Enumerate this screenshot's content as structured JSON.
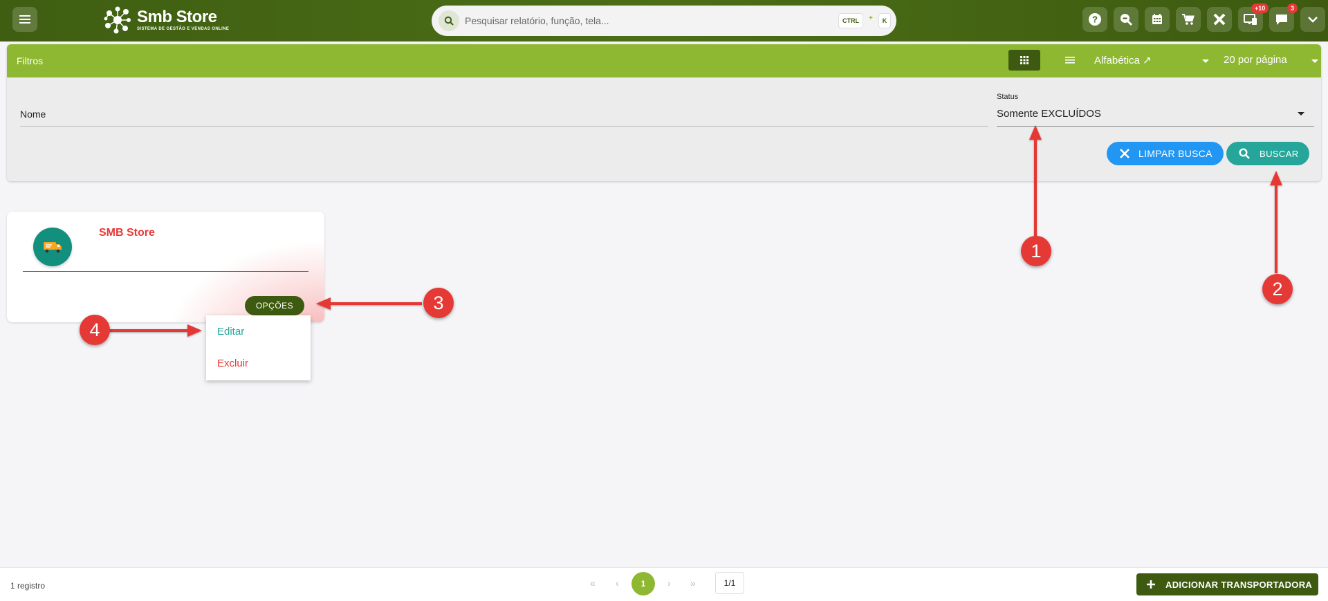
{
  "header": {
    "app_title": "Smb Store",
    "app_subtitle": "SISTEMA DE GESTÃO E VENDAS ONLINE",
    "search_placeholder": "Pesquisar relatório, função, tela...",
    "shortcut_key1": "CTRL",
    "shortcut_plus": "+",
    "shortcut_key2": "K",
    "icons": [
      "help-icon",
      "zoom-out-icon",
      "calendar-icon",
      "cart-icon",
      "tools-icon",
      "monitor-icon",
      "chat-icon",
      "chevron-down-icon"
    ],
    "badge_monitor": "+10",
    "badge_chat": "3"
  },
  "filters": {
    "title": "Filtros",
    "sort_label": "Alfabética ↗",
    "per_page_label": "20 por página",
    "name_field_label": "Nome",
    "status_label": "Status",
    "status_value": "Somente EXCLUÍDOS",
    "clear_button": "LIMPAR BUSCA",
    "search_button": "BUSCAR"
  },
  "card": {
    "title": "SMB Store",
    "options_button": "OPÇÕES",
    "menu": {
      "edit": "Editar",
      "delete": "Excluir"
    }
  },
  "annotations": {
    "marker1": "1",
    "marker2": "2",
    "marker3": "3",
    "marker4": "4",
    "arrow_color": "#e53935"
  },
  "footer": {
    "records": "1 registro",
    "current_page": "1",
    "page_info": "1/1",
    "add_button": "ADICIONAR TRANSPORTADORA"
  },
  "colors": {
    "header_green": "#3f5e12",
    "filters_green": "#8fb832",
    "dark_green": "#3d5a10",
    "blue": "#2196f3",
    "teal": "#26a69a",
    "red": "#e53935"
  }
}
